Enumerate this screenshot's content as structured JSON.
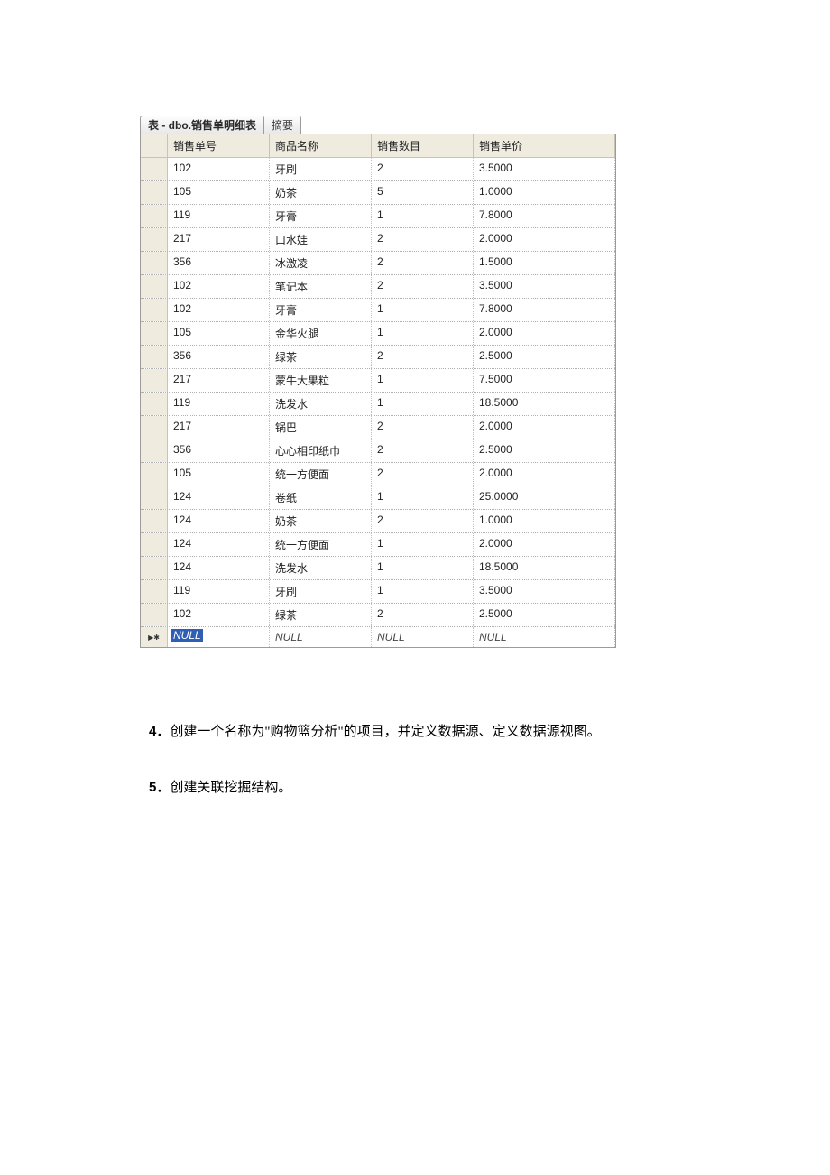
{
  "tab": {
    "title": "表 - dbo.销售单明细表",
    "subtab": "摘要"
  },
  "columns": [
    "销售单号",
    "商品名称",
    "销售数目",
    "销售单价"
  ],
  "rows": [
    [
      "102",
      "牙刷",
      "2",
      "3.5000"
    ],
    [
      "105",
      "奶茶",
      "5",
      "1.0000"
    ],
    [
      "119",
      "牙膏",
      "1",
      "7.8000"
    ],
    [
      "217",
      "口水娃",
      "2",
      "2.0000"
    ],
    [
      "356",
      "冰激凌",
      "2",
      "1.5000"
    ],
    [
      "102",
      "笔记本",
      "2",
      "3.5000"
    ],
    [
      "102",
      "牙膏",
      "1",
      "7.8000"
    ],
    [
      "105",
      "金华火腿",
      "1",
      "2.0000"
    ],
    [
      "356",
      "绿茶",
      "2",
      "2.5000"
    ],
    [
      "217",
      "蒙牛大果粒",
      "1",
      "7.5000"
    ],
    [
      "119",
      "洗发水",
      "1",
      "18.5000"
    ],
    [
      "217",
      "锅巴",
      "2",
      "2.0000"
    ],
    [
      "356",
      "心心相印纸巾",
      "2",
      "2.5000"
    ],
    [
      "105",
      "统一方便面",
      "2",
      "2.0000"
    ],
    [
      "124",
      "卷纸",
      "1",
      "25.0000"
    ],
    [
      "124",
      "奶茶",
      "2",
      "1.0000"
    ],
    [
      "124",
      "统一方便面",
      "1",
      "2.0000"
    ],
    [
      "124",
      "洗发水",
      "1",
      "18.5000"
    ],
    [
      "119",
      "牙刷",
      "1",
      "3.5000"
    ],
    [
      "102",
      "绿茶",
      "2",
      "2.5000"
    ]
  ],
  "null_row": {
    "indicator": "▶✱",
    "values": [
      "NULL",
      "NULL",
      "NULL",
      "NULL"
    ]
  },
  "paragraphs": {
    "p4": "创建一个名称为\"购物篮分析\"的项目，并定义数据源、定义数据源视图。",
    "p5": "创建关联挖掘结构。"
  }
}
